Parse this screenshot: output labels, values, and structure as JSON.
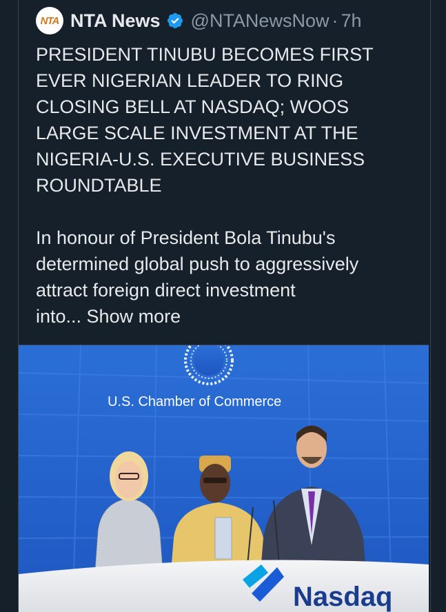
{
  "tweet": {
    "avatar_label": "NTA",
    "display_name": "NTA News",
    "handle": "@NTANewsNow",
    "separator": "·",
    "time": "7h",
    "headline": "PRESIDENT TINUBU BECOMES FIRST\nEVER NIGERIAN LEADER TO RING\nCLOSING BELL AT NASDAQ; WOOS\nLARGE SCALE INVESTMENT AT THE\nNIGERIA-U.S. EXECUTIVE BUSINESS\nROUNDTABLE",
    "body": "In honour of President Bola Tinubu's\ndetermined global push to aggressively\nattract foreign direct investment\ninto... ",
    "show_more": "Show more"
  },
  "media": {
    "backdrop_text": "U.S. Chamber of Commerce",
    "podium_brand": "Nasdaq"
  },
  "colors": {
    "background": "#15202b",
    "text_primary": "#e7e9ea",
    "text_secondary": "#8b98a5",
    "verified": "#1d9bf0",
    "nasdaq_blue": "#1a5cd6"
  }
}
